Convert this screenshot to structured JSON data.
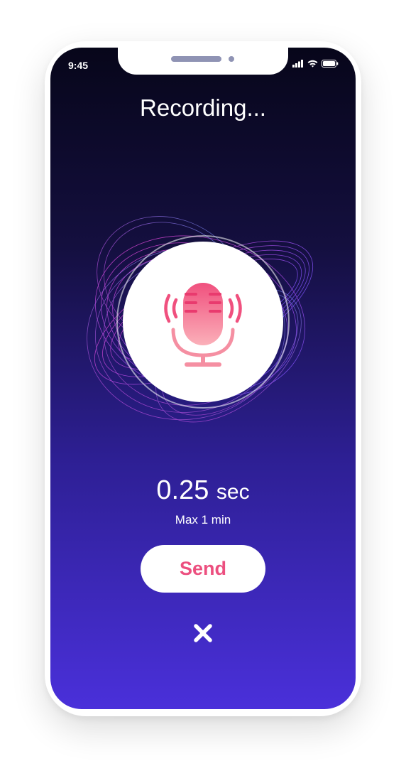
{
  "status_bar": {
    "time": "9:45",
    "icons": [
      "signal-icon",
      "wifi-icon",
      "battery-icon"
    ]
  },
  "screen": {
    "title": "Recording...",
    "timer_value": "0.25",
    "timer_unit": "sec",
    "max_duration_note": "Max 1 min",
    "send_label": "Send"
  },
  "icons": {
    "microphone": "microphone-icon",
    "close": "close-icon"
  },
  "colors": {
    "gradient_top": "#07061a",
    "gradient_bottom": "#4a30da",
    "accent_pink": "#ec4f7f",
    "wave_pink": "#e040c8",
    "wave_blue": "#5b6fe8"
  }
}
